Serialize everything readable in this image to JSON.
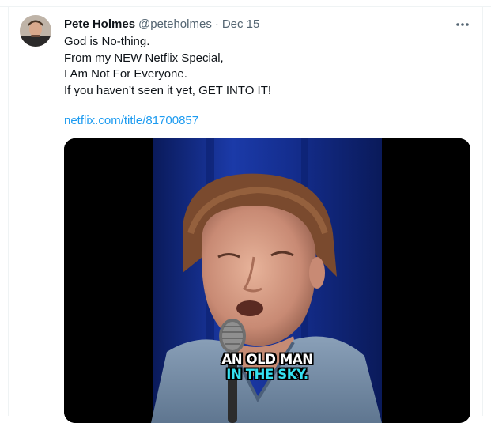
{
  "tweet": {
    "display_name": "Pete Holmes",
    "handle": "@peteholmes",
    "separator": "·",
    "date": "Dec 15",
    "text_lines": [
      "God is No-thing.",
      "From my NEW Netflix Special,",
      "I Am Not For Everyone.",
      "If you haven’t seen it yet, GET INTO IT!"
    ],
    "link": "netflix.com/title/81700857",
    "more_icon": "more-horizontal-icon",
    "media": {
      "caption_line1": "AN OLD MAN",
      "caption_line2": "IN THE SKY."
    }
  },
  "colors": {
    "text": "#0f1419",
    "secondary": "#536471",
    "link": "#1d9bf0",
    "caption_accent": "#35e0f0"
  }
}
